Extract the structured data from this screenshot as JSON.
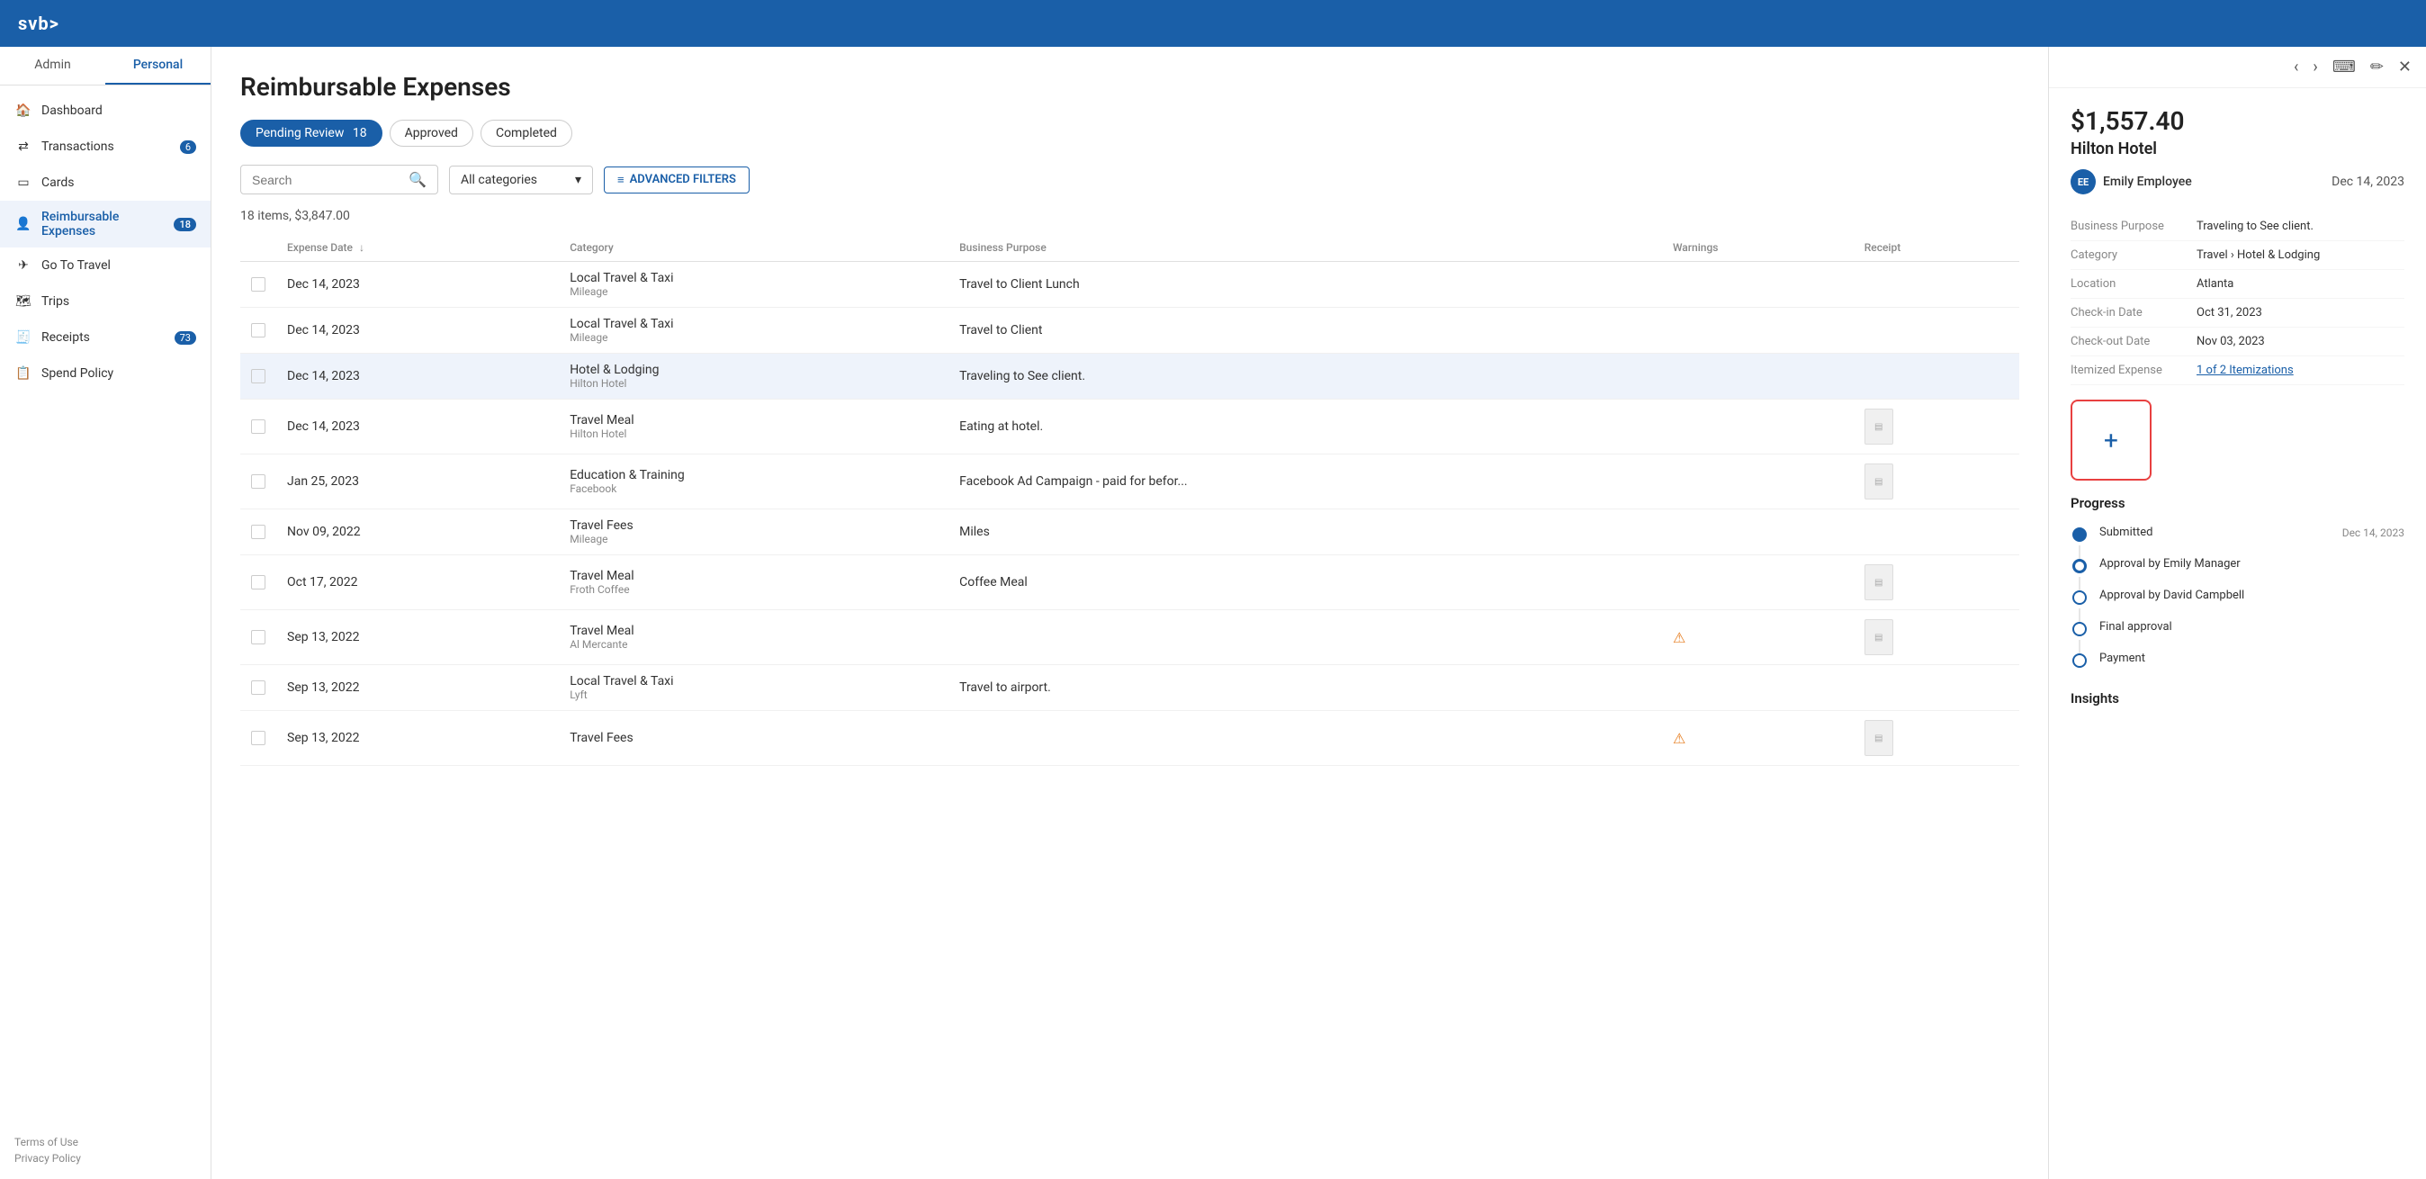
{
  "topbar": {
    "logo": "svb>"
  },
  "sidebar": {
    "tabs": [
      {
        "id": "admin",
        "label": "Admin",
        "active": false
      },
      {
        "id": "personal",
        "label": "Personal",
        "active": true
      }
    ],
    "nav_items": [
      {
        "id": "dashboard",
        "label": "Dashboard",
        "icon": "🏠",
        "badge": null
      },
      {
        "id": "transactions",
        "label": "Transactions",
        "icon": "↔",
        "badge": "6"
      },
      {
        "id": "cards",
        "label": "Cards",
        "icon": "💳",
        "badge": null
      },
      {
        "id": "reimbursable",
        "label": "Reimbursable Expenses",
        "icon": "👤",
        "badge": "18",
        "active": true
      },
      {
        "id": "go-to-travel",
        "label": "Go To Travel",
        "icon": "✈",
        "badge": null
      },
      {
        "id": "trips",
        "label": "Trips",
        "icon": "🗺",
        "badge": null
      },
      {
        "id": "receipts",
        "label": "Receipts",
        "icon": "🧾",
        "badge": "73"
      },
      {
        "id": "spend-policy",
        "label": "Spend Policy",
        "icon": "📋",
        "badge": null
      }
    ],
    "footer": {
      "links": [
        "Terms of Use",
        "Privacy Policy"
      ]
    }
  },
  "main": {
    "title": "Reimbursable Expenses",
    "filter_tabs": [
      {
        "id": "pending",
        "label": "Pending Review",
        "count": "18",
        "active": true
      },
      {
        "id": "approved",
        "label": "Approved",
        "count": null,
        "active": false
      },
      {
        "id": "completed",
        "label": "Completed",
        "count": null,
        "active": false
      }
    ],
    "search": {
      "placeholder": "Search"
    },
    "category_select": {
      "label": "All categories"
    },
    "advanced_filters_label": "ADVANCED FILTERS",
    "items_count": "18 items, $3,847.00",
    "table": {
      "headers": [
        "",
        "Expense Date",
        "Category",
        "Business Purpose",
        "Warnings",
        "Receipt"
      ],
      "rows": [
        {
          "date": "Dec 14, 2023",
          "category": "Local Travel & Taxi",
          "subcategory": "Mileage",
          "business_purpose": "Travel to Client Lunch",
          "warning": false,
          "receipt": false,
          "selected": false
        },
        {
          "date": "Dec 14, 2023",
          "category": "Local Travel & Taxi",
          "subcategory": "Mileage",
          "business_purpose": "Travel to Client",
          "warning": false,
          "receipt": false,
          "selected": false
        },
        {
          "date": "Dec 14, 2023",
          "category": "Hotel & Lodging",
          "subcategory": "Hilton Hotel",
          "business_purpose": "Traveling to See client.",
          "warning": false,
          "receipt": false,
          "selected": true
        },
        {
          "date": "Dec 14, 2023",
          "category": "Travel Meal",
          "subcategory": "Hilton Hotel",
          "business_purpose": "Eating at hotel.",
          "warning": false,
          "receipt": true,
          "selected": false
        },
        {
          "date": "Jan 25, 2023",
          "category": "Education & Training",
          "subcategory": "Facebook",
          "business_purpose": "Facebook Ad Campaign - paid for befor...",
          "warning": false,
          "receipt": true,
          "selected": false
        },
        {
          "date": "Nov 09, 2022",
          "category": "Travel Fees",
          "subcategory": "Mileage",
          "business_purpose": "Miles",
          "warning": false,
          "receipt": false,
          "selected": false
        },
        {
          "date": "Oct 17, 2022",
          "category": "Travel Meal",
          "subcategory": "Froth Coffee",
          "business_purpose": "Coffee Meal",
          "warning": false,
          "receipt": true,
          "selected": false
        },
        {
          "date": "Sep 13, 2022",
          "category": "Travel Meal",
          "subcategory": "Al Mercante",
          "business_purpose": "",
          "warning": true,
          "receipt": true,
          "selected": false
        },
        {
          "date": "Sep 13, 2022",
          "category": "Local Travel & Taxi",
          "subcategory": "Lyft",
          "business_purpose": "Travel to airport.",
          "warning": false,
          "receipt": false,
          "selected": false
        },
        {
          "date": "Sep 13, 2022",
          "category": "Travel Fees",
          "subcategory": "",
          "business_purpose": "",
          "warning": true,
          "receipt": true,
          "selected": false
        }
      ]
    }
  },
  "detail_panel": {
    "amount": "$1,557.40",
    "merchant": "Hilton Hotel",
    "employee_name": "Emily Employee",
    "employee_initials": "EE",
    "date": "Dec 14, 2023",
    "fields": {
      "business_purpose_label": "Business Purpose",
      "business_purpose": "Traveling to See client.",
      "category_label": "Category",
      "category": "Travel › Hotel & Lodging",
      "location_label": "Location",
      "location": "Atlanta",
      "checkin_label": "Check-in Date",
      "checkin": "Oct 31, 2023",
      "checkout_label": "Check-out Date",
      "checkout": "Nov 03, 2023",
      "itemized_label": "Itemized Expense",
      "itemized": "1 of 2 Itemizations"
    },
    "progress": {
      "title": "Progress",
      "steps": [
        {
          "name": "Submitted",
          "date": "Dec 14, 2023",
          "status": "filled"
        },
        {
          "name": "Approval by Emily Manager",
          "date": "",
          "status": "in-progress"
        },
        {
          "name": "Approval by David Campbell",
          "date": "",
          "status": "empty"
        },
        {
          "name": "Final approval",
          "date": "",
          "status": "empty"
        },
        {
          "name": "Payment",
          "date": "",
          "status": "empty"
        }
      ]
    },
    "insights_title": "Insights"
  }
}
